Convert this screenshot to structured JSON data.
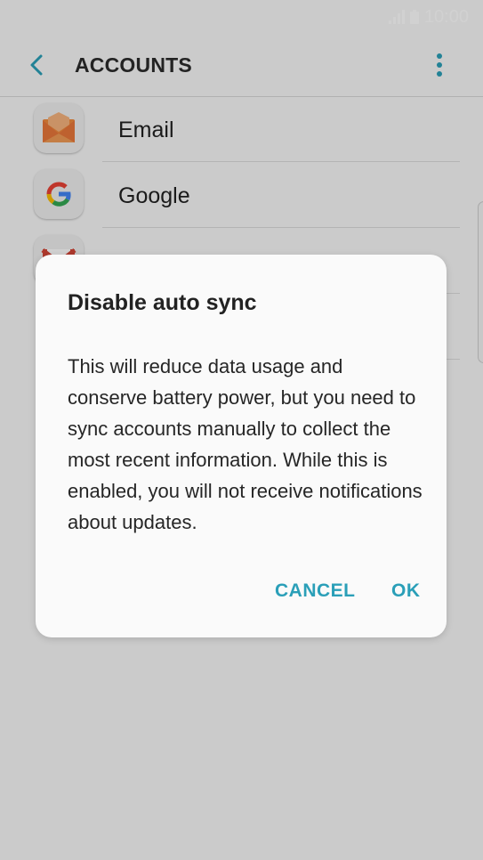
{
  "status_bar": {
    "time": "10:00"
  },
  "header": {
    "title": "ACCOUNTS"
  },
  "accounts": [
    {
      "label": "Email",
      "icon": "email-icon"
    },
    {
      "label": "Google",
      "icon": "google-icon"
    },
    {
      "label": "",
      "icon": "gmail-icon"
    }
  ],
  "dialog": {
    "title": "Disable auto sync",
    "body": "This will reduce data usage and conserve battery power, but you need to sync accounts manually to collect the most recent information. While this is enabled, you will not receive notifications about updates.",
    "cancel_label": "CANCEL",
    "ok_label": "OK"
  },
  "colors": {
    "accent": "#2a9fb8",
    "background": "#f8f8f8",
    "dialog": "#fafafa"
  }
}
